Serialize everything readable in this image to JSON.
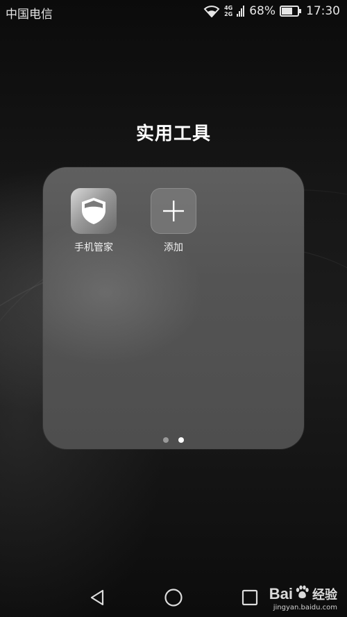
{
  "status_bar": {
    "carrier": "中国电信",
    "network_top": "4G",
    "network_bottom": "2G",
    "battery_percent": "68%",
    "battery_level": 0.68,
    "time": "17:30"
  },
  "folder": {
    "title": "实用工具",
    "apps": [
      {
        "label": "手机管家",
        "icon": "shield-icon"
      },
      {
        "label": "添加",
        "icon": "plus-icon"
      }
    ],
    "page_count": 2,
    "active_page": 2
  },
  "nav_bar": {
    "back_icon": "back-triangle-icon",
    "home_icon": "home-circle-icon",
    "recent_icon": "recent-square-icon"
  },
  "watermark": {
    "logo_text_left": "Bai",
    "logo_text_right": "经验",
    "url": "jingyan.baidu.com"
  }
}
